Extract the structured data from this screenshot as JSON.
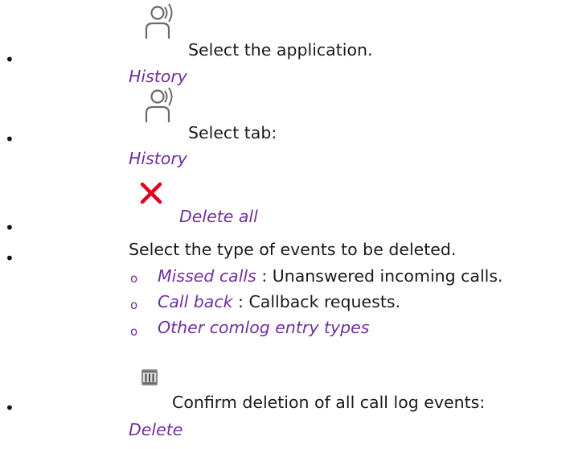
{
  "steps": [
    {
      "icon": "contact-history-icon",
      "text": "Select the application.",
      "value": "History"
    },
    {
      "icon": "contact-history-icon",
      "text": "Select tab:",
      "value": "History"
    },
    {
      "icon": "close-x-icon",
      "value": "Delete all"
    },
    {
      "text": "Select the type of events to be deleted."
    },
    {
      "icon": "trash-icon",
      "text": "Confirm deletion of all call log events:",
      "value": "Delete"
    }
  ],
  "subitems": [
    {
      "value": "Missed calls",
      "text": " : Unanswered incoming calls."
    },
    {
      "value": "Call back",
      "text": " : Callback requests."
    },
    {
      "value": "Other comlog entry types",
      "text": ""
    }
  ],
  "colors": {
    "accent": "#7030a0",
    "delete_icon": "#e0001b"
  }
}
